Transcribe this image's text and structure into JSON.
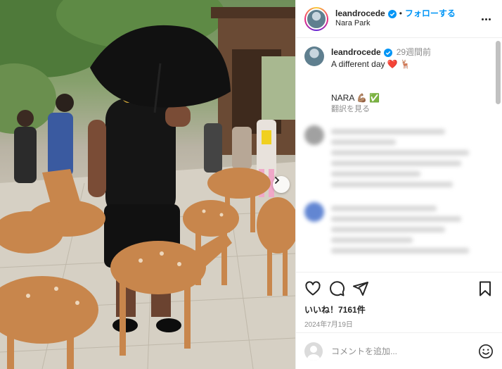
{
  "post": {
    "username": "leandrocede",
    "separator": "•",
    "follow_label": "フォローする",
    "location": "Nara Park",
    "more_label": "…"
  },
  "caption": {
    "username": "leandrocede",
    "time": "29週間前",
    "line1": "A different day ❤️ 🦌",
    "line2": "NARA 💪🏽 ✅",
    "translate_label": "翻訳を見る"
  },
  "engagement": {
    "likes": "いいね！7161件",
    "date": "2024年7月19日"
  },
  "comment_box": {
    "placeholder": "コメントを追加..."
  },
  "icons": {
    "verified": "verified-badge-icon",
    "like": "heart-icon",
    "comment": "comment-icon",
    "share": "share-icon",
    "save": "bookmark-icon",
    "emoji": "emoji-icon",
    "next": "chevron-right-icon"
  },
  "colors": {
    "accent": "#0095f6",
    "text": "#262626",
    "muted": "#8e8e8e",
    "border": "#efefef"
  }
}
